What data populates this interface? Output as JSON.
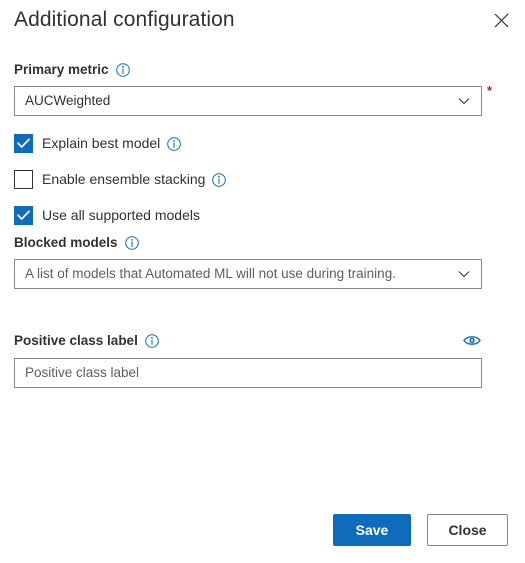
{
  "header": {
    "title": "Additional configuration",
    "close_icon": "close-icon"
  },
  "form": {
    "primary_metric": {
      "label": "Primary metric",
      "info_icon": "info-icon",
      "value": "AUCWeighted",
      "required_marker": "*",
      "chevron_icon": "chevron-down-icon"
    },
    "checkboxes": [
      {
        "label": "Explain best model",
        "checked": true,
        "has_info": true
      },
      {
        "label": "Enable ensemble stacking",
        "checked": false,
        "has_info": true
      },
      {
        "label": "Use all supported models",
        "checked": true,
        "has_info": false
      }
    ],
    "blocked_models": {
      "label": "Blocked models",
      "info_icon": "info-icon",
      "placeholder": "A list of models that Automated ML will not use during training.",
      "value": "",
      "chevron_icon": "chevron-down-icon"
    },
    "positive_class_label": {
      "label": "Positive class label",
      "info_icon": "info-icon",
      "eye_icon": "eye-icon",
      "placeholder": "Positive class label",
      "value": ""
    }
  },
  "footer": {
    "save_label": "Save",
    "close_label": "Close"
  },
  "colors": {
    "accent": "#0f6cbd",
    "required": "#a4262c",
    "text": "#323130",
    "border": "#8a8886",
    "background": "#ffffff"
  }
}
